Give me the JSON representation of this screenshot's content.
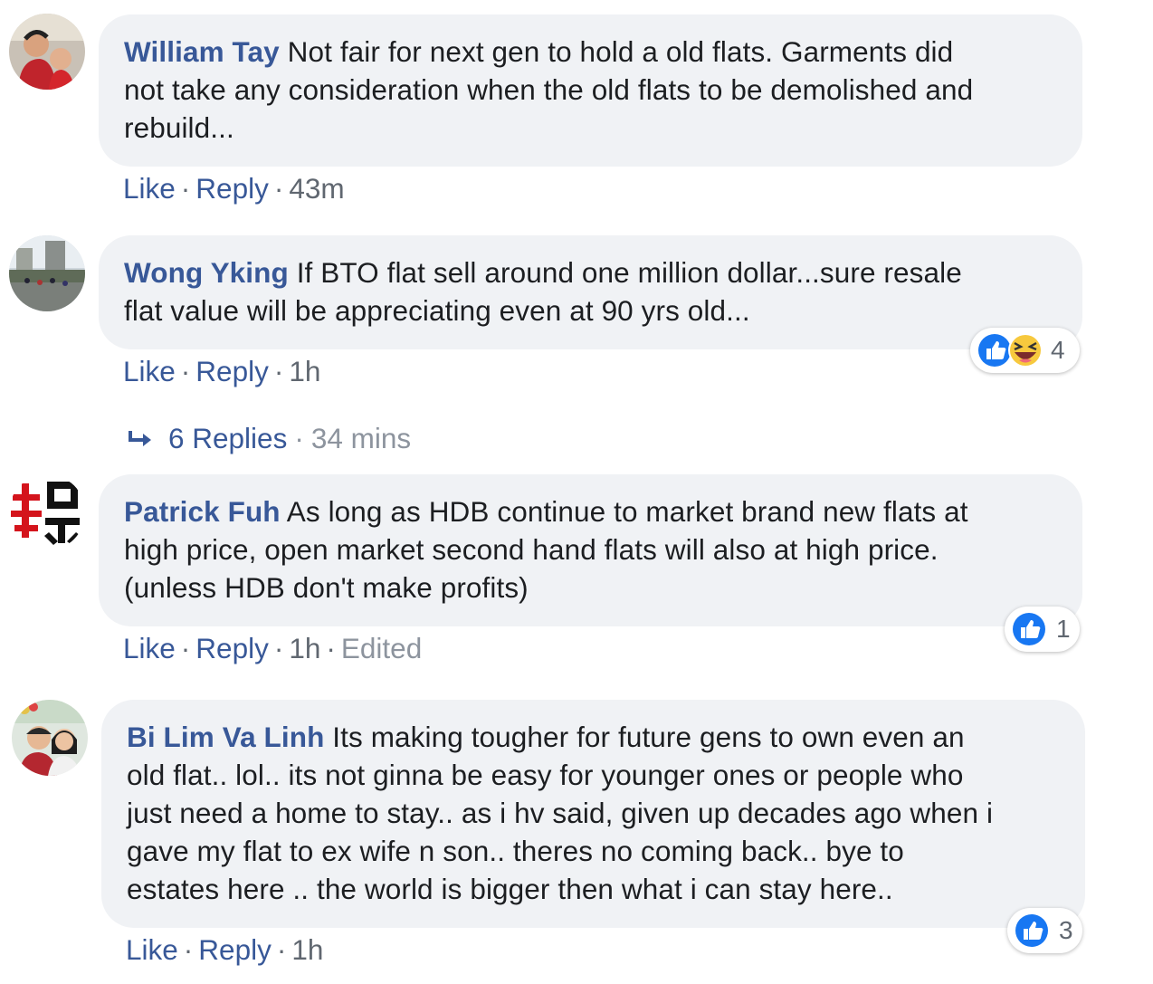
{
  "comments": [
    {
      "author": "William Tay",
      "lines": [
        " Not fair for next gen to hold a old flats. Garments did",
        "not take any consideration when the old flats to be demolished and",
        "rebuild..."
      ],
      "like": "Like",
      "reply": "Reply",
      "time": "43m",
      "edited": "",
      "reaction_count": ""
    },
    {
      "author": "Wong Yking",
      "lines": [
        " If BTO flat sell around one million dollar...sure resale",
        "flat value will be appreciating even at 90 yrs old..."
      ],
      "like": "Like",
      "reply": "Reply",
      "time": "1h",
      "edited": "",
      "reaction_count": "4",
      "reactions": [
        "like-reaction-icon",
        "haha-reaction-icon"
      ]
    },
    {
      "author": "Patrick Fuh",
      "lines": [
        " As long as HDB continue to market brand new flats at",
        "high price, open market second hand flats will also at high price.",
        "(unless HDB don't make profits)"
      ],
      "like": "Like",
      "reply": "Reply",
      "time": "1h",
      "edited": "Edited",
      "reaction_count": "1",
      "reactions": [
        "like-reaction-icon"
      ]
    },
    {
      "author": "Bi Lim Va Linh",
      "lines": [
        " Its making tougher for future gens to own even an",
        "old flat.. lol.. its not ginna be easy for younger ones or people who",
        "just need a home to stay.. as i hv said, given up decades ago when i",
        "gave my flat to ex wife n son.. theres no coming back.. bye to",
        "estates here .. the world is bigger then what i can stay here.."
      ],
      "like": "Like",
      "reply": "Reply",
      "time": "1h",
      "edited": "",
      "reaction_count": "3",
      "reactions": [
        "like-reaction-icon"
      ]
    }
  ],
  "replies_thread": {
    "label": "6 Replies",
    "separator": "·",
    "time": "34 mins",
    "icon": "reply-arrow-icon"
  },
  "separator": "·",
  "colors": {
    "link": "#385898",
    "bubble": "#f0f2f5",
    "muted": "#606770",
    "like_blue": "#1877f2",
    "haha_yellow": "#f7c93e"
  }
}
